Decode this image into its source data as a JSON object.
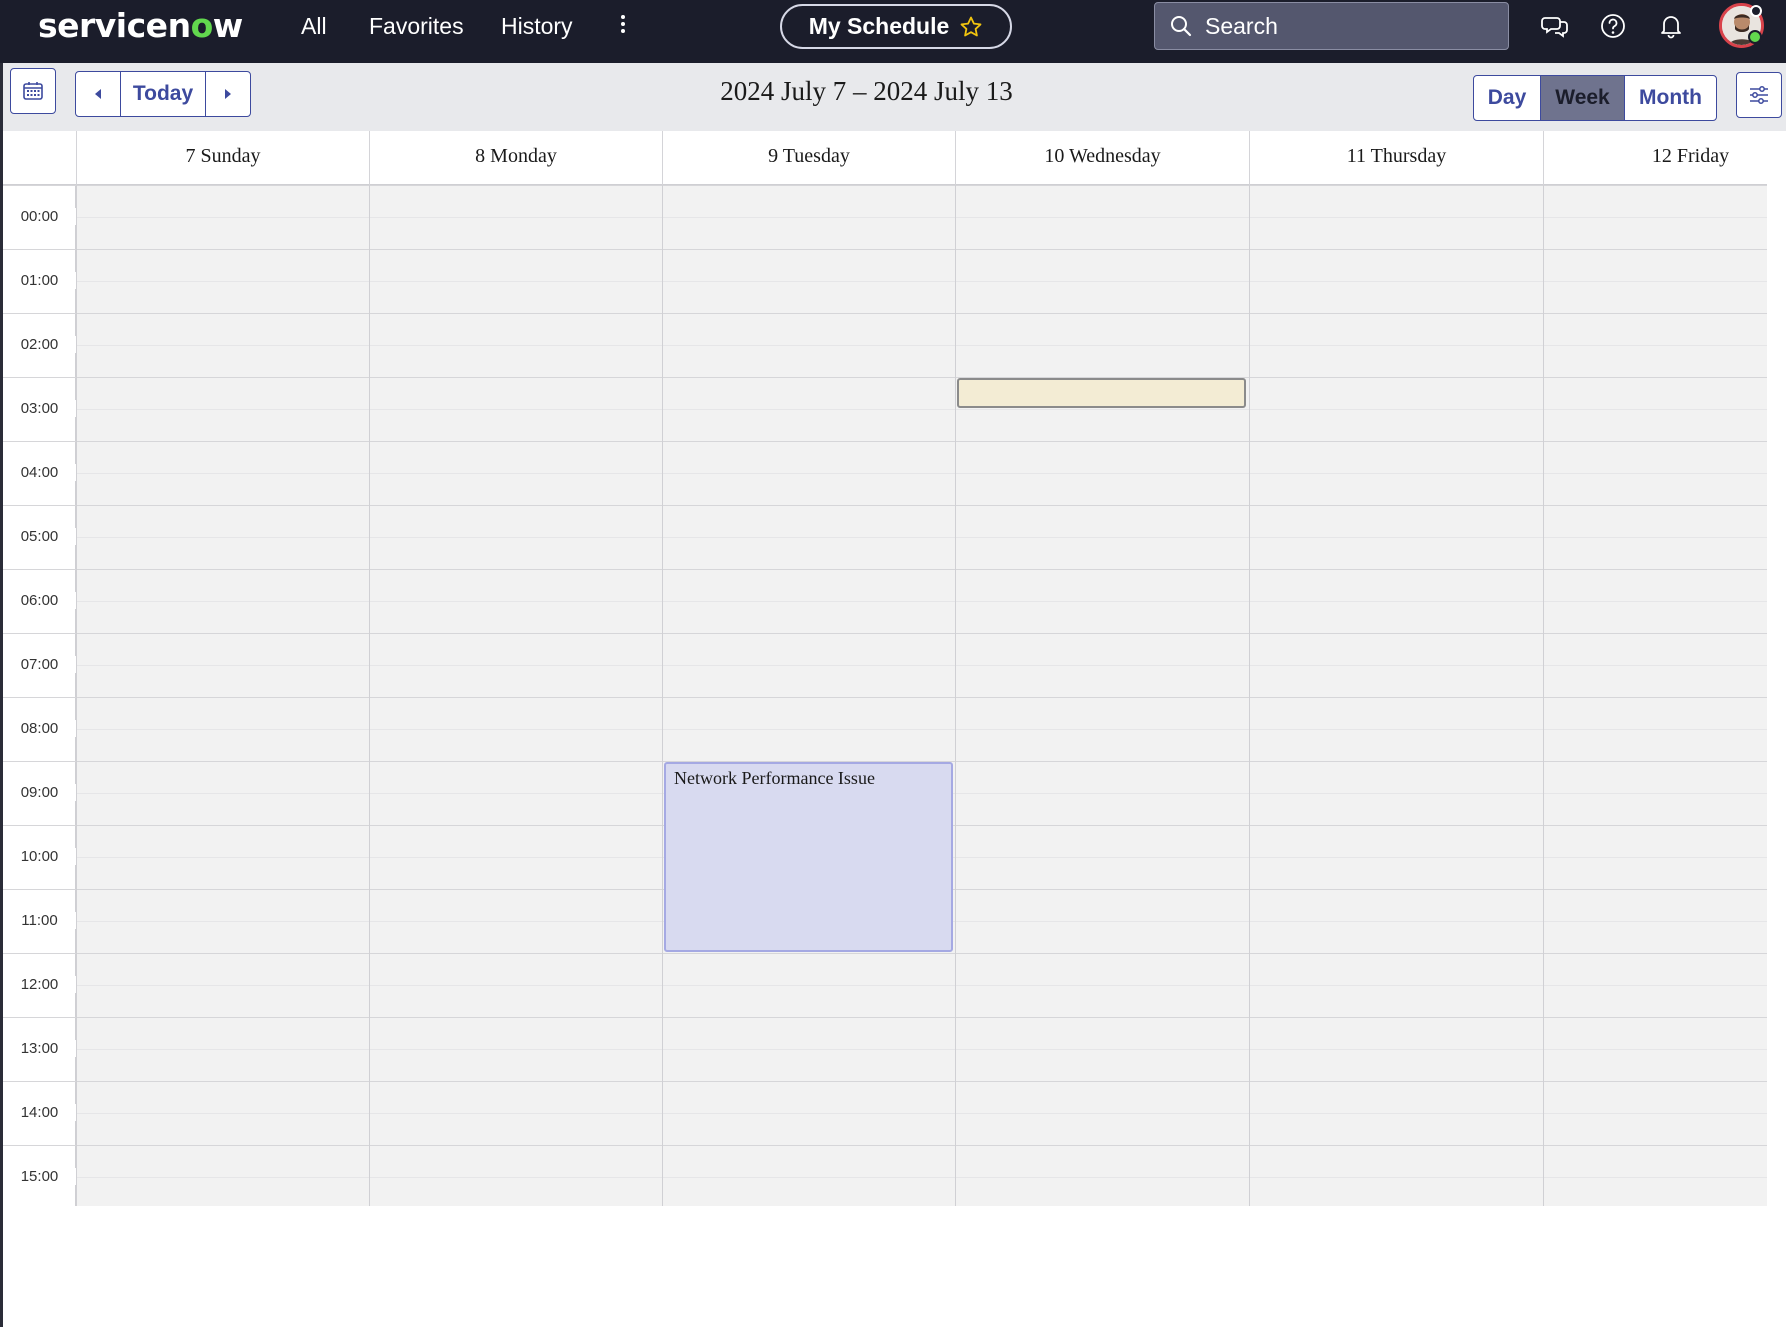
{
  "app": {
    "logo_text_prefix": "servicen",
    "logo_text_o": "o",
    "logo_text_suffix": "w",
    "brand_color": "#62d84e"
  },
  "nav": {
    "all": "All",
    "favorites": "Favorites",
    "history": "History",
    "more_icon": "more-vertical-icon"
  },
  "workspace": {
    "title": "My Schedule",
    "favorite_icon": "star-outline-icon"
  },
  "search": {
    "placeholder": "Search",
    "icon": "search-icon"
  },
  "header_icons": [
    "chat-icon",
    "help-icon",
    "bell-icon"
  ],
  "toolbar": {
    "calendar_icon": "calendar-icon",
    "prev_icon": "caret-left-icon",
    "today_label": "Today",
    "next_icon": "caret-right-icon",
    "range_title": "2024 July 7 – 2024 July 13",
    "views": [
      {
        "label": "Day",
        "active": false
      },
      {
        "label": "Week",
        "active": true
      },
      {
        "label": "Month",
        "active": false
      }
    ],
    "settings_icon": "sliders-icon"
  },
  "calendar": {
    "days": [
      "7 Sunday",
      "8 Monday",
      "9 Tuesday",
      "10 Wednesday",
      "11 Thursday",
      "12 Friday"
    ],
    "hours": [
      "00:00",
      "01:00",
      "02:00",
      "03:00",
      "04:00",
      "05:00",
      "06:00",
      "07:00",
      "08:00",
      "09:00",
      "10:00",
      "11:00",
      "12:00",
      "13:00",
      "14:00",
      "15:00"
    ],
    "events": [
      {
        "title": "",
        "day_index": 3,
        "start_hour": 3.0,
        "end_hour": 3.5,
        "color": "#f3ecd4",
        "border": "#8b8b8b"
      },
      {
        "title": "Network Performance Issue",
        "day_index": 2,
        "start_hour": 9.0,
        "end_hour": 12.0,
        "color": "#d8daf0",
        "border": "#a5a9e3"
      }
    ]
  }
}
